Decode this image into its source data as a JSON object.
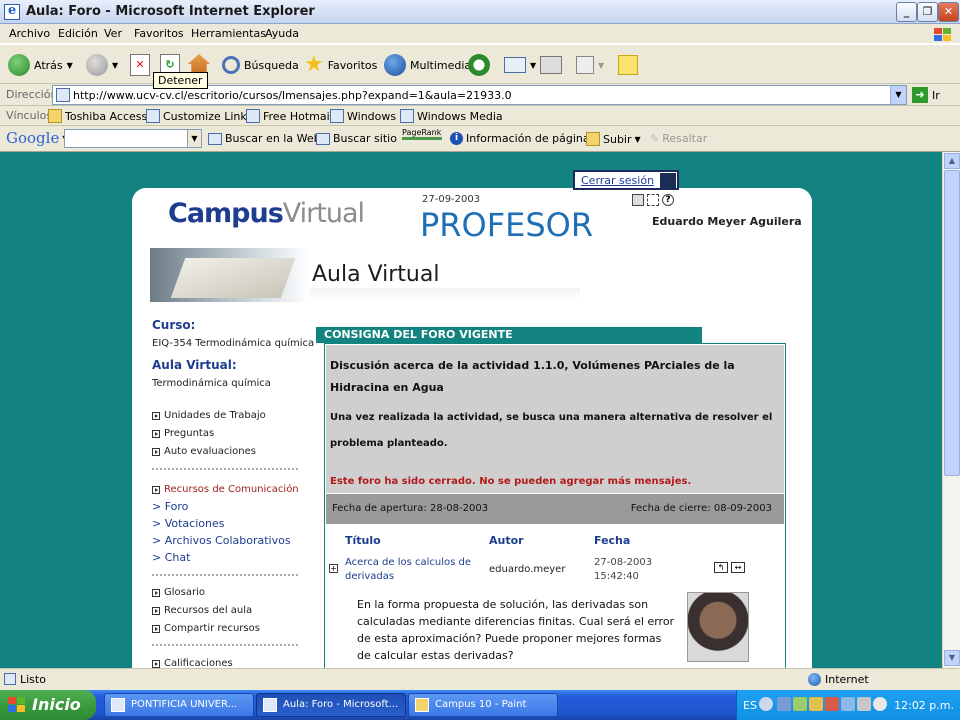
{
  "window": {
    "title": "Aula: Foro - Microsoft Internet Explorer"
  },
  "menu": [
    "Archivo",
    "Edición",
    "Ver",
    "Favoritos",
    "Herramientas",
    "Ayuda"
  ],
  "toolbar": {
    "back": "Atrás",
    "search": "Búsqueda",
    "favorites": "Favoritos",
    "media": "Multimedia",
    "tooltip": "Detener"
  },
  "address": {
    "label": "Dirección",
    "url": "http://www.ucv-cv.cl/escritorio/cursos/lmensajes.php?expand=1&aula=21933.0",
    "go": "Ir"
  },
  "links": {
    "label": "Vínculos",
    "items": [
      "Toshiba Access",
      "Customize Links",
      "Free Hotmail",
      "Windows",
      "Windows Media"
    ]
  },
  "google": {
    "logo": "Google",
    "search_web": "Buscar en la Web",
    "search_site": "Buscar sitio",
    "pagerank": "PageRank",
    "page_info": "Información de página",
    "up": "Subir",
    "highlight": "Resaltar"
  },
  "site": {
    "logo_a": "Campus",
    "logo_b": "Virtual",
    "date": "27-09-2003",
    "role": "PROFESOR",
    "user": "Eduardo Meyer Aguilera",
    "section": "Aula Virtual",
    "logout": "Cerrar sesión"
  },
  "sidebar": {
    "course_head": "Curso:",
    "course_val": "EIQ-354 Termodinámica química",
    "aula_head": "Aula Virtual:",
    "aula_val": "Termodinámica química",
    "nav1": [
      "Unidades de Trabajo",
      "Preguntas",
      "Auto evaluaciones"
    ],
    "nav2_head": "Recursos de Comunicación",
    "nav2_sub": [
      "> Foro",
      "> Votaciones",
      "> Archivos Colaborativos",
      "> Chat"
    ],
    "nav3": [
      "Glosario",
      "Recursos del aula",
      "Compartir recursos"
    ],
    "nav4": [
      "Calificaciones"
    ]
  },
  "forum": {
    "tab": "CONSIGNA DEL FORO VIGENTE",
    "title": "Discusión acerca de la actividad 1.1.0, Volúmenes PArciales de la Hidracina en Agua",
    "desc": "Una vez realizada la actividad, se busca una manera alternativa de resolver el problema planteado.",
    "closed": "Este foro ha sido cerrado. No se pueden agregar más mensajes.",
    "open_label": "Fecha de apertura:  28-08-2003",
    "close_label": "Fecha de cierre:  08-09-2003",
    "col_title": "Título",
    "col_author": "Autor",
    "col_date": "Fecha",
    "topic": "Acerca de los calculos de derivadas",
    "author": "eduardo.meyer",
    "date1": "27-08-2003",
    "date2": "15:42:40",
    "body": "En la forma propuesta de solución, las derivadas son calculadas mediante diferencias finitas. Cual será el error de esta aproximación? Puede proponer mejores formas de calcular estas derivadas?"
  },
  "status": {
    "left": "Listo",
    "zone": "Internet"
  },
  "taskbar": {
    "start": "Inicio",
    "tasks": [
      "PONTIFICIA UNIVER...",
      "Aula: Foro - Microsoft...",
      "Campus 10 - Paint"
    ],
    "lang": "ES",
    "clock": "12:02 p.m."
  }
}
